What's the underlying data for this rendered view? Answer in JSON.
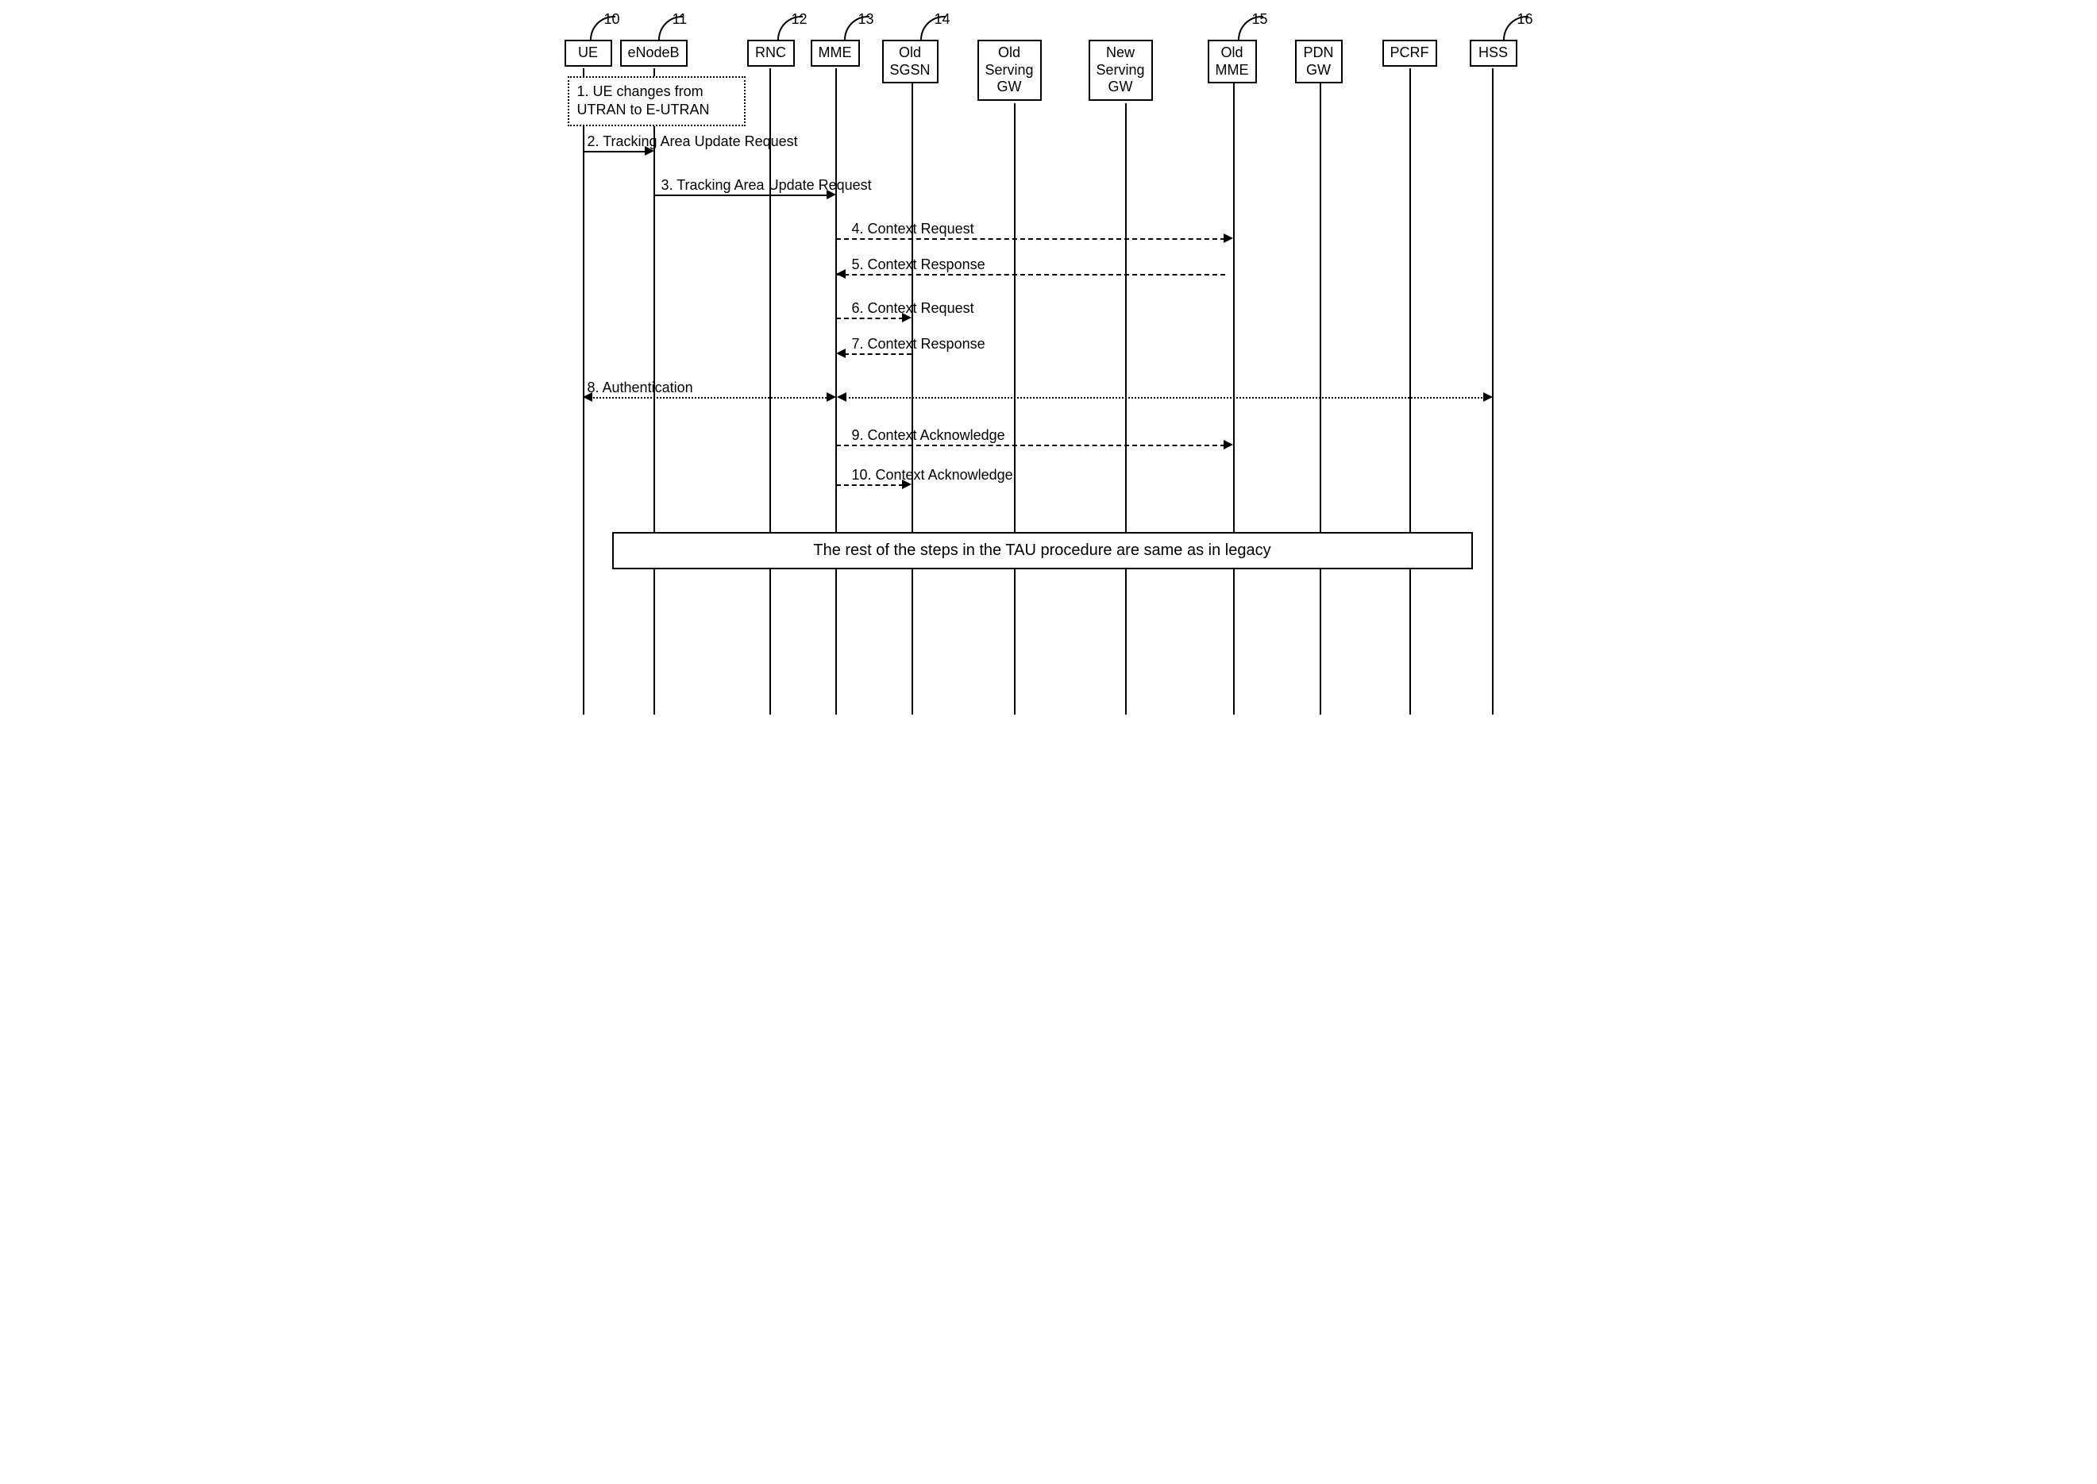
{
  "actors": {
    "ue": {
      "label": "UE",
      "ref": "10"
    },
    "enodeb": {
      "label": "eNodeB",
      "ref": "11"
    },
    "rnc": {
      "label": "RNC",
      "ref": "12"
    },
    "mme": {
      "label": "MME",
      "ref": "13"
    },
    "old_sgsn": {
      "label": "Old\nSGSN",
      "ref": "14"
    },
    "old_serving_gw": {
      "label": "Old\nServing\nGW"
    },
    "new_serving_gw": {
      "label": "New\nServing\nGW"
    },
    "old_mme": {
      "label": "Old\nMME",
      "ref": "15"
    },
    "pdn_gw": {
      "label": "PDN\nGW"
    },
    "pcrf": {
      "label": "PCRF"
    },
    "hss": {
      "label": "HSS",
      "ref": "16"
    }
  },
  "note1": "1. UE changes from\nUTRAN to E-UTRAN",
  "messages": {
    "m2": "2. Tracking Area Update Request",
    "m3": "3. Tracking Area Update Request",
    "m4": "4. Context Request",
    "m5": "5. Context Response",
    "m6": "6. Context Request",
    "m7": "7. Context Response",
    "m8": "8. Authentication",
    "m9": "9. Context Acknowledge",
    "m10": "10. Context Acknowledge"
  },
  "final_note": "The rest of the steps in the TAU procedure are same as in legacy",
  "chart_data": {
    "type": "sequence-diagram",
    "participants": [
      {
        "id": "UE",
        "ref": "10"
      },
      {
        "id": "eNodeB",
        "ref": "11"
      },
      {
        "id": "RNC",
        "ref": "12"
      },
      {
        "id": "MME",
        "ref": "13"
      },
      {
        "id": "Old SGSN",
        "ref": "14"
      },
      {
        "id": "Old Serving GW"
      },
      {
        "id": "New Serving GW"
      },
      {
        "id": "Old MME",
        "ref": "15"
      },
      {
        "id": "PDN GW"
      },
      {
        "id": "PCRF"
      },
      {
        "id": "HSS",
        "ref": "16"
      }
    ],
    "interactions": [
      {
        "step": 1,
        "type": "note",
        "at": [
          "UE",
          "eNodeB"
        ],
        "text": "UE changes from UTRAN to E-UTRAN"
      },
      {
        "step": 2,
        "from": "UE",
        "to": "eNodeB",
        "text": "Tracking Area Update Request",
        "style": "solid"
      },
      {
        "step": 3,
        "from": "eNodeB",
        "to": "MME",
        "text": "Tracking Area Update Request",
        "style": "solid"
      },
      {
        "step": 4,
        "from": "MME",
        "to": "Old MME",
        "text": "Context Request",
        "style": "dashed"
      },
      {
        "step": 5,
        "from": "Old MME",
        "to": "MME",
        "text": "Context Response",
        "style": "dashed"
      },
      {
        "step": 6,
        "from": "MME",
        "to": "Old SGSN",
        "text": "Context Request",
        "style": "dashed"
      },
      {
        "step": 7,
        "from": "Old SGSN",
        "to": "MME",
        "text": "Context Response",
        "style": "dashed"
      },
      {
        "step": 8,
        "from": "UE",
        "to": "HSS",
        "via": "MME",
        "text": "Authentication",
        "style": "dotted",
        "bidirectional": true
      },
      {
        "step": 9,
        "from": "MME",
        "to": "Old MME",
        "text": "Context Acknowledge",
        "style": "dashed"
      },
      {
        "step": 10,
        "from": "MME",
        "to": "Old SGSN",
        "text": "Context Acknowledge",
        "style": "dashed"
      },
      {
        "type": "note-box",
        "text": "The rest of the steps in the TAU procedure are same as in legacy"
      }
    ]
  }
}
